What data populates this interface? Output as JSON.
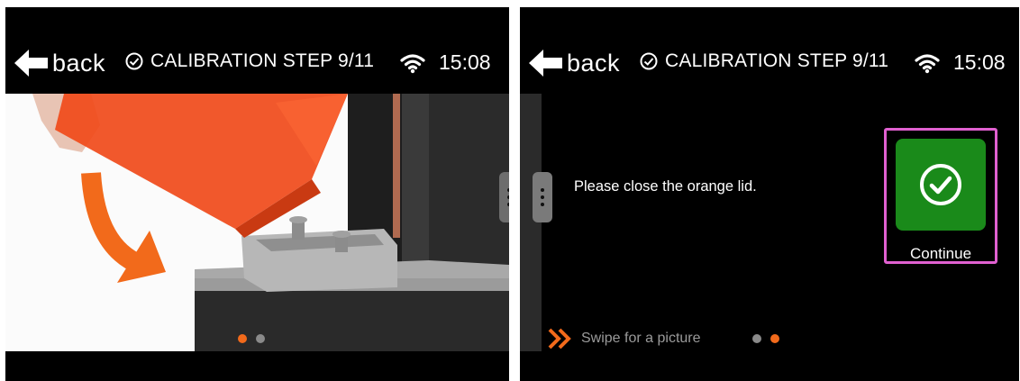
{
  "colors": {
    "background": "#000000",
    "accent_orange": "#f26a1b",
    "dot_inactive": "#8a8a8a",
    "continue_green": "#1a8a1a",
    "highlight_pink": "#e060d0"
  },
  "screens": [
    {
      "header": {
        "back_label": "back",
        "step_label": "CALIBRATION STEP 9/11",
        "time": "15:08"
      },
      "image": {
        "description_icon": "orange-lid-closing-illustration"
      },
      "pager": {
        "active_index": 0,
        "count": 2
      }
    },
    {
      "header": {
        "back_label": "back",
        "step_label": "CALIBRATION STEP 9/11",
        "time": "15:08"
      },
      "instruction": "Please close the orange lid.",
      "continue_label": "Continue",
      "swipe_hint": "Swipe for a picture",
      "pager": {
        "active_index": 1,
        "count": 2
      }
    }
  ]
}
